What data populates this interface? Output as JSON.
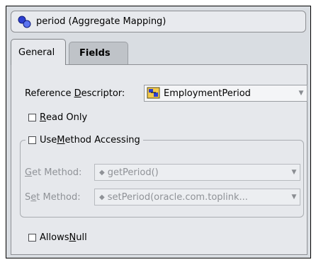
{
  "title": {
    "text": "period (Aggregate Mapping)",
    "icon": "aggregate-mapping-icon"
  },
  "tabs": [
    {
      "label": "General",
      "active": true
    },
    {
      "label": "Fields",
      "active": false
    }
  ],
  "reference_descriptor": {
    "label_prefix": "Reference ",
    "label_mnemonic": "D",
    "label_suffix": "escriptor:",
    "value": "EmploymentPeriod"
  },
  "read_only": {
    "mnemonic": "R",
    "rest": "ead Only",
    "checked": false
  },
  "method_accessing": {
    "prefix": "Use ",
    "mnemonic": "M",
    "rest": "ethod Accessing",
    "checked": false
  },
  "get_method": {
    "mnemonic": "G",
    "rest": "et Method:",
    "value": "getPeriod()"
  },
  "set_method": {
    "prefix": "S",
    "mnemonic": "e",
    "rest": "t Method:",
    "value": "setPeriod(oracle.com.toplink..."
  },
  "allows_null": {
    "prefix": "Allows ",
    "mnemonic": "N",
    "rest": "ull",
    "checked": false
  },
  "colors": {
    "panel": "#e6e8ec",
    "frame": "#d9dde2",
    "tab_inactive": "#bfc3c8"
  }
}
